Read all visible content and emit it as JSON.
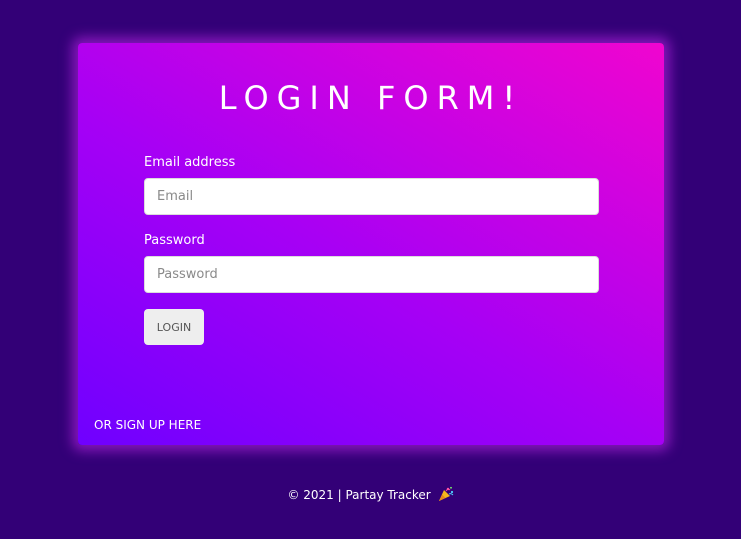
{
  "form": {
    "title": "LOGIN FORM!",
    "email_label": "Email address",
    "email_placeholder": "Email",
    "email_value": "",
    "password_label": "Password",
    "password_placeholder": "Password",
    "password_value": "",
    "login_label": "LOGIN",
    "signup_label": "OR SIGN UP HERE"
  },
  "footer": {
    "text": "© 2021 | Partay Tracker",
    "icon": "party-popper-icon"
  },
  "colors": {
    "page_background": "#330077",
    "card_gradient_start": "#6f00ff",
    "card_gradient_end": "#f005cf",
    "text": "#ffffff",
    "button_background": "#eeeeee"
  }
}
